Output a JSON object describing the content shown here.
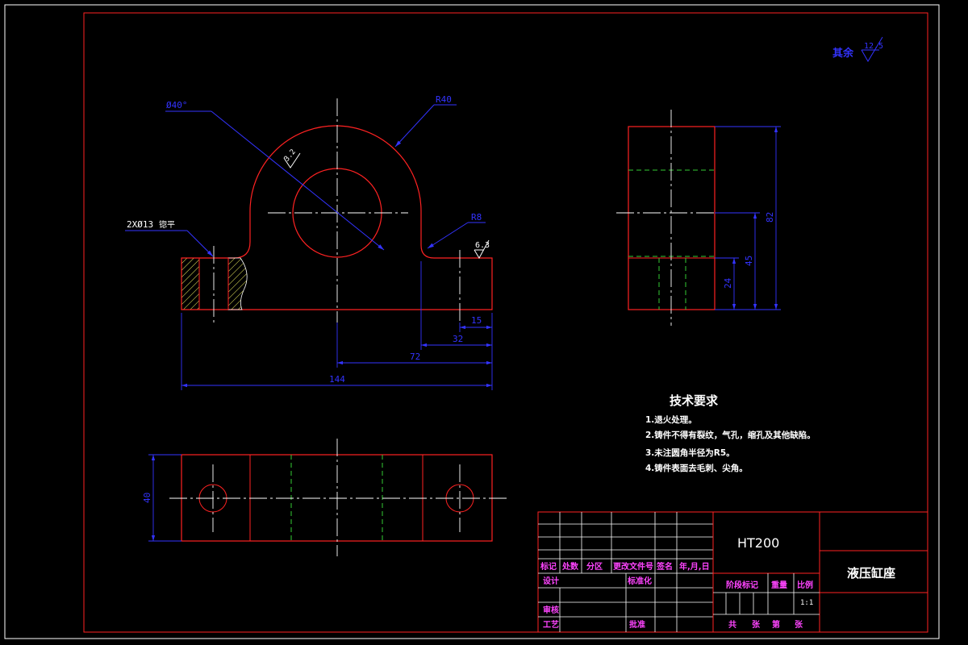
{
  "drawing": {
    "surface_roughness_note": "其余",
    "surface_roughness_value": "12.5",
    "front_view": {
      "dim_bore": "Ø40°",
      "dim_radius_top": "R40",
      "dim_radius_fillet": "R8",
      "dim_holes": "2XØ13",
      "dim_holes_note": "锪平",
      "rough_bore": "3.2",
      "rough_base": "6.3",
      "dim_15": "15",
      "dim_32": "32",
      "dim_72": "72",
      "dim_144": "144"
    },
    "side_view": {
      "dim_82": "82",
      "dim_45": "45",
      "dim_24": "24"
    },
    "top_view": {
      "dim_40": "40"
    },
    "technical_requirements": {
      "title": "技术要求",
      "items": [
        "1.退火处理。",
        "2.铸件不得有裂纹，气孔，缩孔及其他缺陷。",
        "3.未注圆角半径为R5。",
        "4.铸件表面去毛刺、尖角。"
      ]
    },
    "title_block": {
      "material": "HT200",
      "part_name": "液压缸座",
      "headers": [
        "标记",
        "处数",
        "分区",
        "更改文件号",
        "签名",
        "年,月,日"
      ],
      "design": "设计",
      "standardize": "标准化",
      "review": "审核",
      "process": "工艺",
      "approve": "批准",
      "stage_mark": "阶段标记",
      "weight": "重量",
      "scale": "比例",
      "scale_value": "1:1",
      "total": "共",
      "sheet": "张",
      "page_no": "第",
      "page": "张"
    }
  }
}
